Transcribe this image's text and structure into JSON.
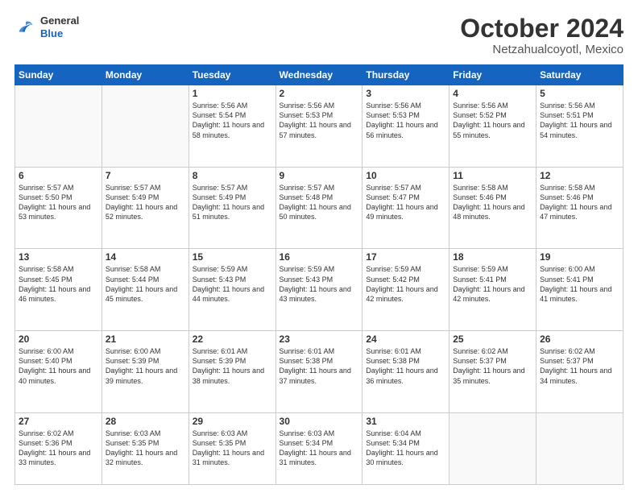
{
  "logo": {
    "general": "General",
    "blue": "Blue"
  },
  "title": "October 2024",
  "location": "Netzahualcoyotl, Mexico",
  "days_of_week": [
    "Sunday",
    "Monday",
    "Tuesday",
    "Wednesday",
    "Thursday",
    "Friday",
    "Saturday"
  ],
  "weeks": [
    [
      {
        "day": "",
        "empty": true
      },
      {
        "day": "",
        "empty": true
      },
      {
        "day": "1",
        "sunrise": "5:56 AM",
        "sunset": "5:54 PM",
        "daylight": "11 hours and 58 minutes."
      },
      {
        "day": "2",
        "sunrise": "5:56 AM",
        "sunset": "5:53 PM",
        "daylight": "11 hours and 57 minutes."
      },
      {
        "day": "3",
        "sunrise": "5:56 AM",
        "sunset": "5:53 PM",
        "daylight": "11 hours and 56 minutes."
      },
      {
        "day": "4",
        "sunrise": "5:56 AM",
        "sunset": "5:52 PM",
        "daylight": "11 hours and 55 minutes."
      },
      {
        "day": "5",
        "sunrise": "5:56 AM",
        "sunset": "5:51 PM",
        "daylight": "11 hours and 54 minutes."
      }
    ],
    [
      {
        "day": "6",
        "sunrise": "5:57 AM",
        "sunset": "5:50 PM",
        "daylight": "11 hours and 53 minutes."
      },
      {
        "day": "7",
        "sunrise": "5:57 AM",
        "sunset": "5:49 PM",
        "daylight": "11 hours and 52 minutes."
      },
      {
        "day": "8",
        "sunrise": "5:57 AM",
        "sunset": "5:49 PM",
        "daylight": "11 hours and 51 minutes."
      },
      {
        "day": "9",
        "sunrise": "5:57 AM",
        "sunset": "5:48 PM",
        "daylight": "11 hours and 50 minutes."
      },
      {
        "day": "10",
        "sunrise": "5:57 AM",
        "sunset": "5:47 PM",
        "daylight": "11 hours and 49 minutes."
      },
      {
        "day": "11",
        "sunrise": "5:58 AM",
        "sunset": "5:46 PM",
        "daylight": "11 hours and 48 minutes."
      },
      {
        "day": "12",
        "sunrise": "5:58 AM",
        "sunset": "5:46 PM",
        "daylight": "11 hours and 47 minutes."
      }
    ],
    [
      {
        "day": "13",
        "sunrise": "5:58 AM",
        "sunset": "5:45 PM",
        "daylight": "11 hours and 46 minutes."
      },
      {
        "day": "14",
        "sunrise": "5:58 AM",
        "sunset": "5:44 PM",
        "daylight": "11 hours and 45 minutes."
      },
      {
        "day": "15",
        "sunrise": "5:59 AM",
        "sunset": "5:43 PM",
        "daylight": "11 hours and 44 minutes."
      },
      {
        "day": "16",
        "sunrise": "5:59 AM",
        "sunset": "5:43 PM",
        "daylight": "11 hours and 43 minutes."
      },
      {
        "day": "17",
        "sunrise": "5:59 AM",
        "sunset": "5:42 PM",
        "daylight": "11 hours and 42 minutes."
      },
      {
        "day": "18",
        "sunrise": "5:59 AM",
        "sunset": "5:41 PM",
        "daylight": "11 hours and 42 minutes."
      },
      {
        "day": "19",
        "sunrise": "6:00 AM",
        "sunset": "5:41 PM",
        "daylight": "11 hours and 41 minutes."
      }
    ],
    [
      {
        "day": "20",
        "sunrise": "6:00 AM",
        "sunset": "5:40 PM",
        "daylight": "11 hours and 40 minutes."
      },
      {
        "day": "21",
        "sunrise": "6:00 AM",
        "sunset": "5:39 PM",
        "daylight": "11 hours and 39 minutes."
      },
      {
        "day": "22",
        "sunrise": "6:01 AM",
        "sunset": "5:39 PM",
        "daylight": "11 hours and 38 minutes."
      },
      {
        "day": "23",
        "sunrise": "6:01 AM",
        "sunset": "5:38 PM",
        "daylight": "11 hours and 37 minutes."
      },
      {
        "day": "24",
        "sunrise": "6:01 AM",
        "sunset": "5:38 PM",
        "daylight": "11 hours and 36 minutes."
      },
      {
        "day": "25",
        "sunrise": "6:02 AM",
        "sunset": "5:37 PM",
        "daylight": "11 hours and 35 minutes."
      },
      {
        "day": "26",
        "sunrise": "6:02 AM",
        "sunset": "5:37 PM",
        "daylight": "11 hours and 34 minutes."
      }
    ],
    [
      {
        "day": "27",
        "sunrise": "6:02 AM",
        "sunset": "5:36 PM",
        "daylight": "11 hours and 33 minutes."
      },
      {
        "day": "28",
        "sunrise": "6:03 AM",
        "sunset": "5:35 PM",
        "daylight": "11 hours and 32 minutes."
      },
      {
        "day": "29",
        "sunrise": "6:03 AM",
        "sunset": "5:35 PM",
        "daylight": "11 hours and 31 minutes."
      },
      {
        "day": "30",
        "sunrise": "6:03 AM",
        "sunset": "5:34 PM",
        "daylight": "11 hours and 31 minutes."
      },
      {
        "day": "31",
        "sunrise": "6:04 AM",
        "sunset": "5:34 PM",
        "daylight": "11 hours and 30 minutes."
      },
      {
        "day": "",
        "empty": true
      },
      {
        "day": "",
        "empty": true
      }
    ]
  ]
}
